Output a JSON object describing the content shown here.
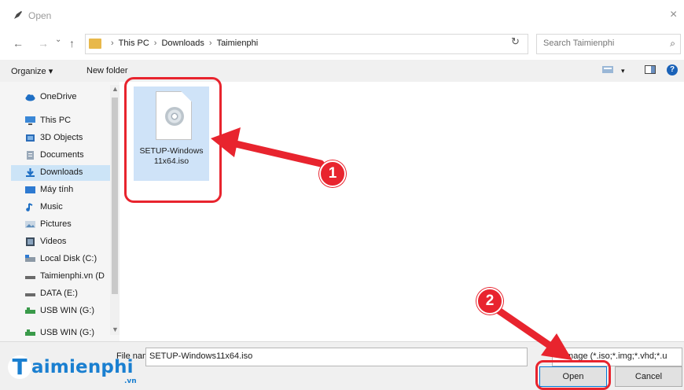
{
  "window": {
    "title": "Open",
    "close_glyph": "×"
  },
  "nav_buttons": {
    "back": "←",
    "forward": "→",
    "recent": "⌄",
    "up": "↑"
  },
  "address": {
    "crumbs": [
      "This PC",
      "Downloads",
      "Taimienphi"
    ],
    "separator": "›"
  },
  "search": {
    "placeholder": "Search Taimienphi"
  },
  "toolbar": {
    "organize_label": "Organize ▾",
    "new_folder_label": "New folder",
    "help_label": "?"
  },
  "sidebar": {
    "items": [
      {
        "label": "OneDrive",
        "icon": "cloud-icon"
      },
      {
        "label": "This PC",
        "icon": "pc-icon"
      },
      {
        "label": "3D Objects",
        "icon": "3d-objects-icon"
      },
      {
        "label": "Documents",
        "icon": "documents-icon"
      },
      {
        "label": "Downloads",
        "icon": "download-icon",
        "selected": true
      },
      {
        "label": "Máy tính",
        "icon": "desktop-icon"
      },
      {
        "label": "Music",
        "icon": "music-icon"
      },
      {
        "label": "Pictures",
        "icon": "pictures-icon"
      },
      {
        "label": "Videos",
        "icon": "videos-icon"
      },
      {
        "label": "Local Disk (C:)",
        "icon": "local-disk-icon"
      },
      {
        "label": "Taimienphi.vn (D",
        "icon": "drive-icon"
      },
      {
        "label": "DATA (E:)",
        "icon": "drive-icon"
      },
      {
        "label": "USB WIN (G:)",
        "icon": "usb-drive-icon"
      },
      {
        "label": "USB WIN (G:)",
        "icon": "usb-drive-icon"
      }
    ]
  },
  "files": [
    {
      "line1": "SETUP-Windows",
      "line2": "11x64.iso",
      "icon": "disc-image-icon"
    }
  ],
  "footer": {
    "filename_label": "File name:",
    "filename_value": "SETUP-Windows11x64.iso",
    "filetype_value": "Image (*.iso;*.img;*.vhd;*.u",
    "open_label": "Open",
    "cancel_label": "Cancel"
  },
  "annotations": {
    "step1": "1",
    "step2": "2",
    "color": "#e8242e"
  },
  "watermark": {
    "initial": "T",
    "text": "aimienphi",
    "suffix": ".vn"
  },
  "colors": {
    "accent": "#0078d7",
    "selection": "#cce4f7",
    "folder": "#e8b84a"
  }
}
